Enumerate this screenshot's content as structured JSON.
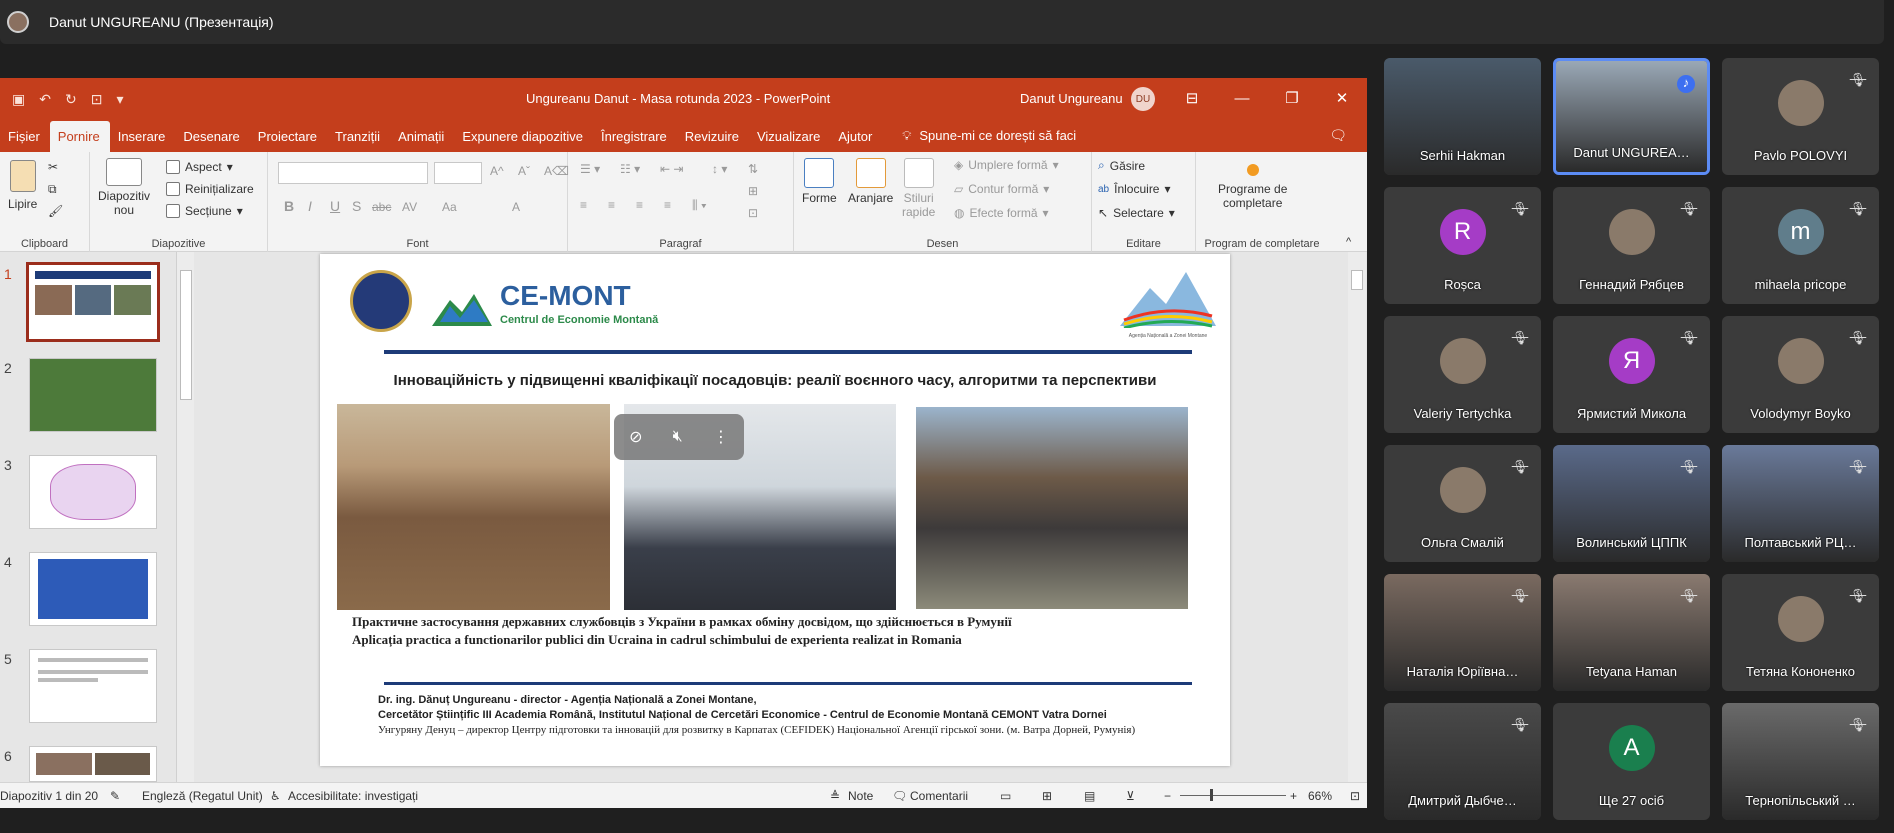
{
  "meeting": {
    "presenter": "Danut UNGUREANU (Презентація)"
  },
  "powerpoint": {
    "title": "Ungureanu Danut - Masa rotunda 2023  -  PowerPoint",
    "user_name": "Danut Ungureanu",
    "user_initials": "DU",
    "tabs": [
      "Fișier",
      "Pornire",
      "Inserare",
      "Desenare",
      "Proiectare",
      "Tranziții",
      "Animații",
      "Expunere diapozitive",
      "Înregistrare",
      "Revizuire",
      "Vizualizare",
      "Ajutor"
    ],
    "tell_me": "Spune-mi ce dorești să faci",
    "ribbon": {
      "clipboard": {
        "label": "Clipboard",
        "paste": "Lipire"
      },
      "slides": {
        "label": "Diapozitive",
        "new_slide_1": "Diapozitiv",
        "new_slide_2": "nou",
        "layout": "Aspect",
        "reset": "Reinițializare",
        "section": "Secțiune"
      },
      "font": {
        "label": "Font",
        "buttons": [
          "B",
          "I",
          "U",
          "S",
          "abc",
          "AV",
          "Aa",
          "A"
        ]
      },
      "paragraph": {
        "label": "Paragraf"
      },
      "drawing": {
        "label": "Desen",
        "shapes": "Forme",
        "arrange": "Aranjare",
        "styles_1": "Stiluri",
        "styles_2": "rapide",
        "fill": "Umplere formă",
        "outline": "Contur formă",
        "effects": "Efecte formă"
      },
      "editing": {
        "label": "Editare",
        "find": "Găsire",
        "replace": "Înlocuire",
        "select": "Selectare"
      },
      "addins": {
        "label": "Program de completare",
        "btn_1": "Programe de",
        "btn_2": "completare"
      }
    },
    "thumb_numbers": [
      "1",
      "2",
      "3",
      "4",
      "5",
      "6"
    ],
    "slide": {
      "logo_name": "CE-MONT",
      "logo_sub": "Centrul de Economie Montană",
      "agency_caption": "Agenția Națională a Zonei Montane",
      "heading": "Інноваційність у підвищенні кваліфікації посадовців: реалії воєнного часу, алгоритми та перспективи",
      "caption_uk": "Практичне застосування державних службовців з України в рамках обміну досвідом, що здійснюється в Румунії",
      "caption_ro": "Aplicația practica a functionarilor publici din Ucraina in cadrul schimbului de experienta realizat in Romania",
      "author_1": "Dr. ing. Dănuț Ungureanu - director - Agenția Națională a Zonei Montane,",
      "author_2": "Cercetător Științific III Academia Română, Institutul Național de Cercetări Economice - Centrul de Economie Montană CEMONT Vatra Dornei",
      "author_3": "Унгуряну Денуц – директор  Центру підготовки та інновацій для розвитку в Карпатах (CEFIDEK)  Національної Агенції гірської зони. (м. Ватра Дорней, Румунія)"
    },
    "status": {
      "slide_count": "Diapozitiv 1 din 20",
      "language": "Engleză (Regatul Unit)",
      "accessibility": "Accesibilitate: investigați",
      "notes": "Note",
      "comments": "Comentarii",
      "zoom": "66%"
    }
  },
  "participants": [
    {
      "name": "Serhii Hakman",
      "muted": false,
      "initial": "",
      "color": ""
    },
    {
      "name": "Danut UNGUREA…",
      "muted": false,
      "initial": "",
      "color": "",
      "speaking": true
    },
    {
      "name": "Pavlo POLOVYI",
      "muted": true,
      "initial": "",
      "color": ""
    },
    {
      "name": "Roșca",
      "muted": true,
      "initial": "R",
      "color": "#a53cc6"
    },
    {
      "name": "Геннадий Рябцев",
      "muted": true,
      "initial": "",
      "color": ""
    },
    {
      "name": "mihaela pricope",
      "muted": true,
      "initial": "m",
      "color": "#607d8b"
    },
    {
      "name": "Valeriy Tertychka",
      "muted": true,
      "initial": "",
      "color": ""
    },
    {
      "name": "Ярмистий Микола",
      "muted": true,
      "initial": "Я",
      "color": "#a53cc6"
    },
    {
      "name": "Volodymyr Boyko",
      "muted": true,
      "initial": "",
      "color": ""
    },
    {
      "name": "Ольга Смалій",
      "muted": true,
      "initial": "",
      "color": ""
    },
    {
      "name": "Волинський ЦППК",
      "muted": true,
      "initial": "",
      "color": ""
    },
    {
      "name": "Полтавський РЦ…",
      "muted": true,
      "initial": "",
      "color": ""
    },
    {
      "name": "Наталія Юріївна…",
      "muted": true,
      "initial": "",
      "color": ""
    },
    {
      "name": "Tetyana Haman",
      "muted": true,
      "initial": "",
      "color": ""
    },
    {
      "name": "Тетяна Кононенко",
      "muted": true,
      "initial": "",
      "color": ""
    },
    {
      "name": "Дмитрий Дыбче…",
      "muted": true,
      "initial": "",
      "color": ""
    },
    {
      "name": "Ще 27 осіб",
      "muted": false,
      "initial": "A",
      "color": "#1a7f4e"
    },
    {
      "name": "Тернопільський …",
      "muted": true,
      "initial": "",
      "color": ""
    }
  ]
}
